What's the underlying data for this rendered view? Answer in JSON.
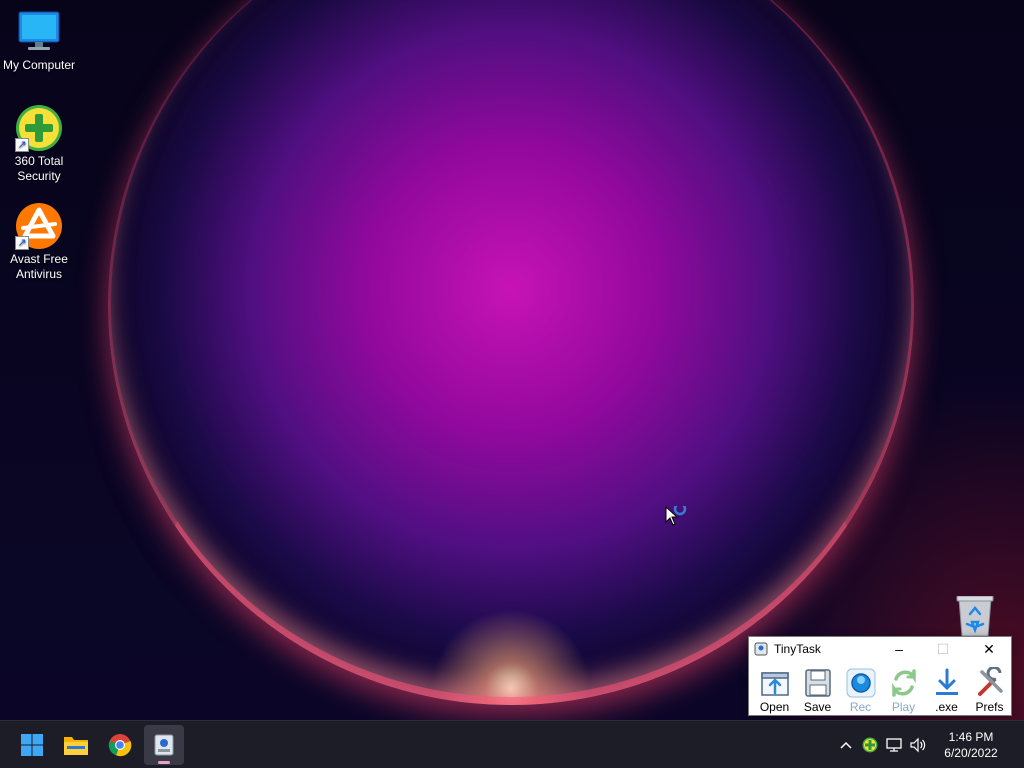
{
  "desktop": {
    "icons": [
      {
        "label": "My Computer"
      },
      {
        "label": "360 Total Security"
      },
      {
        "label": "Avast Free Antivirus"
      }
    ],
    "recycle_bin_icon": "recycle-bin-icon"
  },
  "tinytask": {
    "title": "TinyTask",
    "controls": {
      "minimize": "–",
      "maximize": "☐",
      "close": "✕"
    },
    "buttons": [
      {
        "label": "Open",
        "icon": "open-icon",
        "enabled": true
      },
      {
        "label": "Save",
        "icon": "save-icon",
        "enabled": true
      },
      {
        "label": "Rec",
        "icon": "record-icon",
        "enabled": false
      },
      {
        "label": "Play",
        "icon": "play-icon",
        "enabled": false
      },
      {
        "label": ".exe",
        "icon": "compile-exe-icon",
        "enabled": true
      },
      {
        "label": "Prefs",
        "icon": "prefs-icon",
        "enabled": true
      }
    ]
  },
  "taskbar": {
    "apps": [
      {
        "name": "start",
        "icon": "windows-start-icon"
      },
      {
        "name": "file-explorer",
        "icon": "folder-icon"
      },
      {
        "name": "chrome",
        "icon": "chrome-icon"
      },
      {
        "name": "tinytask",
        "icon": "tinytask-icon",
        "active": true
      }
    ],
    "tray": {
      "overflow": "^",
      "clock_time": "1:46 PM",
      "clock_date": "6/20/2022"
    }
  },
  "colors": {
    "taskbar_bg": "#1d1d27",
    "orb_magenta": "#c814b8",
    "accent_blue": "#1a73e8"
  }
}
